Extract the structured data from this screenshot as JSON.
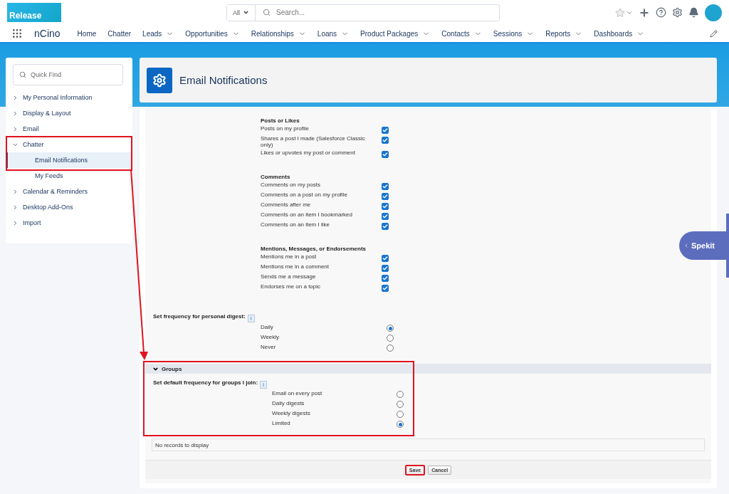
{
  "header": {
    "logo": "Release",
    "search_scope": "All",
    "search_placeholder": "Search..."
  },
  "nav": {
    "app_name": "nCino",
    "items": [
      {
        "label": "Home",
        "has_menu": false
      },
      {
        "label": "Chatter",
        "has_menu": false
      },
      {
        "label": "Leads",
        "has_menu": true
      },
      {
        "label": "Opportunities",
        "has_menu": true
      },
      {
        "label": "Relationships",
        "has_menu": true
      },
      {
        "label": "Loans",
        "has_menu": true
      },
      {
        "label": "Product Packages",
        "has_menu": true
      },
      {
        "label": "Contacts",
        "has_menu": true
      },
      {
        "label": "Sessions",
        "has_menu": true
      },
      {
        "label": "Reports",
        "has_menu": true
      },
      {
        "label": "Dashboards",
        "has_menu": true
      }
    ]
  },
  "sidebar": {
    "search_placeholder": "Quick Find",
    "items": [
      {
        "label": "My Personal Information",
        "expanded": false,
        "highlighted": false
      },
      {
        "label": "Display & Layout",
        "expanded": false,
        "highlighted": false
      },
      {
        "label": "Email",
        "expanded": false,
        "highlighted": false
      },
      {
        "label": "Chatter",
        "expanded": true,
        "highlighted": true,
        "children": [
          {
            "label": "Email Notifications",
            "selected": true
          },
          {
            "label": "My Feeds",
            "selected": false
          }
        ]
      },
      {
        "label": "Calendar & Reminders",
        "expanded": false,
        "highlighted": false
      },
      {
        "label": "Desktop Add-Ons",
        "expanded": false,
        "highlighted": false
      },
      {
        "label": "Import",
        "expanded": false,
        "highlighted": false
      }
    ]
  },
  "page_title": "Email Notifications",
  "sections": [
    {
      "heading": "Posts or Likes",
      "options": [
        {
          "label": "Posts on my profile",
          "checked": true
        },
        {
          "label": "Shares a post I made (Salesforce Classic only)",
          "checked": true
        },
        {
          "label": "Likes or upvotes my post or comment",
          "checked": true
        }
      ]
    },
    {
      "heading": "Comments",
      "options": [
        {
          "label": "Comments on my posts",
          "checked": true
        },
        {
          "label": "Comments on a post on my profile",
          "checked": true
        },
        {
          "label": "Comments after me",
          "checked": true
        },
        {
          "label": "Comments on an item I bookmarked",
          "checked": true
        },
        {
          "label": "Comments on an item I like",
          "checked": true
        }
      ]
    },
    {
      "heading": "Mentions, Messages, or Endorsements",
      "options": [
        {
          "label": "Mentions me in a post",
          "checked": true
        },
        {
          "label": "Mentions me in a comment",
          "checked": true
        },
        {
          "label": "Sends me a message",
          "checked": true
        },
        {
          "label": "Endorses me on a topic",
          "checked": true
        }
      ]
    }
  ],
  "personal_digest": {
    "label": "Set frequency for personal digest:",
    "info": "i",
    "options": [
      {
        "label": "Daily",
        "selected": true
      },
      {
        "label": "Weekly",
        "selected": false
      },
      {
        "label": "Never",
        "selected": false
      }
    ]
  },
  "groups": {
    "title": "Groups",
    "expanded": true,
    "highlighted": true,
    "label": "Set default frequency for groups I join:",
    "info": "i",
    "options": [
      {
        "label": "Email on every post",
        "selected": false
      },
      {
        "label": "Daily digests",
        "selected": false
      },
      {
        "label": "Weekly digests",
        "selected": false
      },
      {
        "label": "Limited",
        "selected": true
      }
    ]
  },
  "empty_message": "No records to display",
  "buttons": [
    {
      "label": "Save",
      "highlighted": true
    },
    {
      "label": "Cancel",
      "highlighted": false
    }
  ],
  "spekit": {
    "label": "Spekit"
  }
}
